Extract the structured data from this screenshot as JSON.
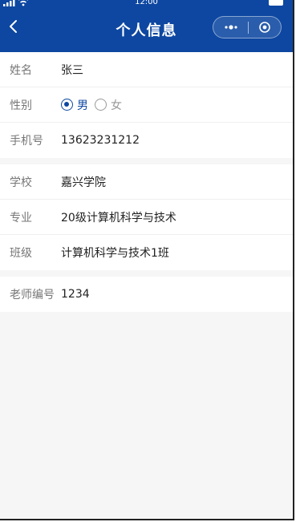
{
  "status_bar": {
    "time": "12:00"
  },
  "nav": {
    "title": "个人信息"
  },
  "profile": {
    "name_label": "姓名",
    "name_value": "张三",
    "gender_label": "性别",
    "gender_options": [
      "男",
      "女"
    ],
    "gender_selected": "男",
    "phone_label": "手机号",
    "phone_value": "13623231212"
  },
  "school_info": {
    "school_label": "学校",
    "school_value": "嘉兴学院",
    "major_label": "专业",
    "major_value": "20级计算机科学与技术",
    "class_label": "班级",
    "class_value": "计算机科学与技术1班"
  },
  "teacher": {
    "id_label": "老师编号",
    "id_value": "1234"
  },
  "colors": {
    "header": "#0d47a1",
    "accent": "#0d47a1"
  }
}
